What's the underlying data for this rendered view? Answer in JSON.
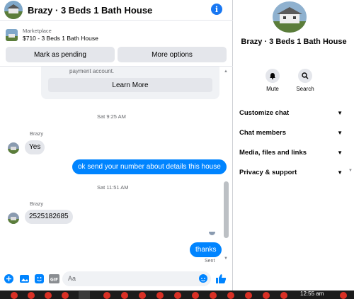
{
  "chat": {
    "title": "Brazy · 3 Beds 1 Bath House",
    "marketplace_label": "Marketplace",
    "listing": "$710 - 3 Beds 1 Bath House",
    "mark_pending": "Mark as pending",
    "more_options": "More options"
  },
  "card": {
    "text": "payment account.",
    "learn_more": "Learn More"
  },
  "messages": {
    "ts1": "Sat 9:25 AM",
    "sender1": "Brazy",
    "msg1": "Yes",
    "out1": "ok send your number about details this house",
    "ts2": "Sat 11:51 AM",
    "sender2": "Brazy",
    "msg2": "2525182685",
    "out2": "thanks",
    "sent": "Sent"
  },
  "composer": {
    "placeholder": "Aa"
  },
  "right_panel": {
    "title": "Brazy · 3 Beds 1 Bath House",
    "mute": "Mute",
    "search": "Search",
    "menu": [
      {
        "label": "Customize chat"
      },
      {
        "label": "Chat members"
      },
      {
        "label": "Media, files and links"
      },
      {
        "label": "Privacy & support"
      }
    ]
  },
  "taskbar": {
    "clock": "12:55 am"
  },
  "colors": {
    "accent": "#0084ff",
    "info": "#1877f2"
  }
}
